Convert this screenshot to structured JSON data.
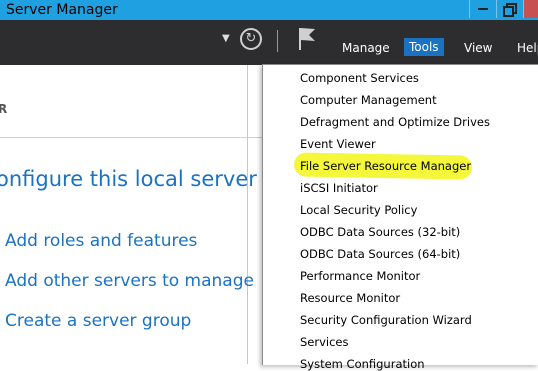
{
  "window": {
    "title": "Server Manager"
  },
  "header": {
    "menus": [
      "Manage",
      "Tools",
      "View",
      "Help"
    ],
    "active_menu": "Tools"
  },
  "left_panel": {
    "header_fragment": "R",
    "heading": "onfigure this local server",
    "actions": [
      "Add roles and features",
      "Add other servers to manage",
      "Create a server group"
    ]
  },
  "tools_menu": {
    "items": [
      "Component Services",
      "Computer Management",
      "Defragment and Optimize Drives",
      "Event Viewer",
      "File Server Resource Manager",
      "iSCSI Initiator",
      "Local Security Policy",
      "ODBC Data Sources (32-bit)",
      "ODBC Data Sources (64-bit)",
      "Performance Monitor",
      "Resource Monitor",
      "Security Configuration Wizard",
      "Services",
      "System Configuration"
    ],
    "highlighted_item": "File Server Resource Manager",
    "highlight_color": "#f4f73a"
  },
  "colors": {
    "titlebar": "#1fa1e1",
    "header": "#2d2d30",
    "accent": "#1a73c2"
  },
  "icons": {
    "refresh": "refresh-icon",
    "flag": "notifications-flag-icon",
    "dropdown": "chevron-down-icon"
  }
}
